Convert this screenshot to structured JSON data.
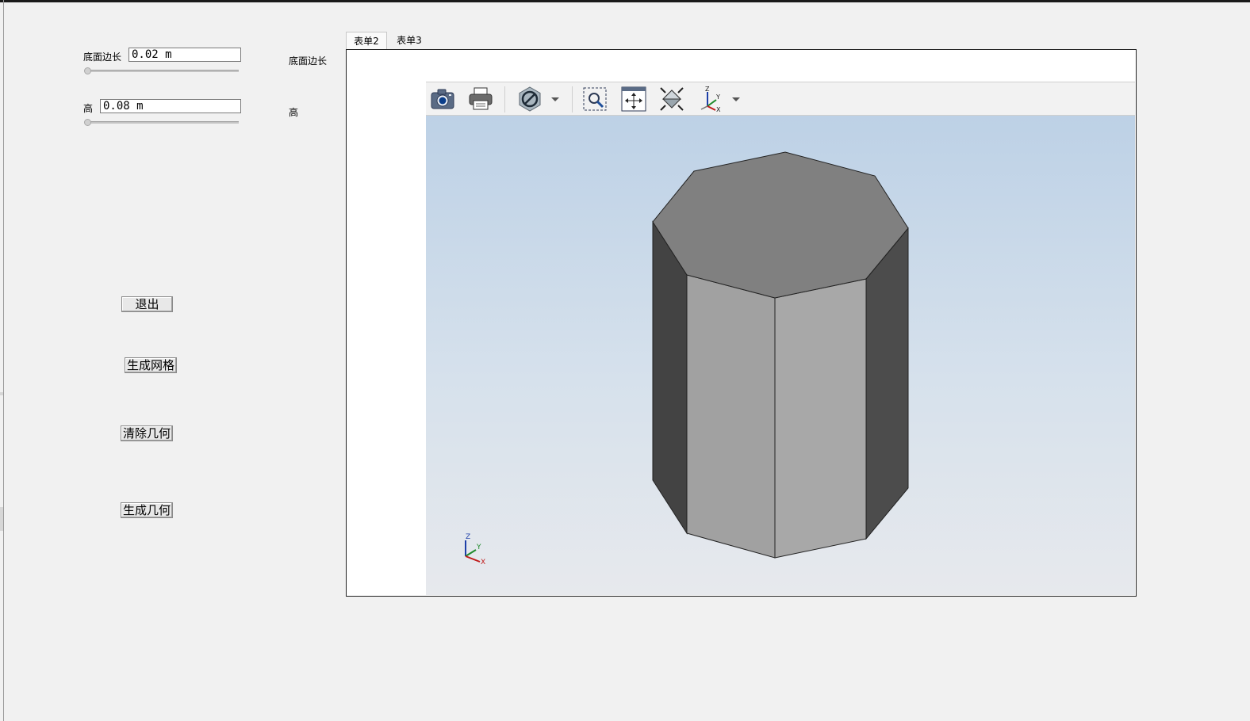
{
  "left_panel": {
    "base_edge": {
      "label": "底面边长",
      "value": "0.02 m",
      "side_label": "底面边长"
    },
    "height": {
      "label": "高",
      "value": "0.08 m",
      "side_label": "高"
    },
    "buttons": {
      "exit": "退出",
      "mesh": "生成网格",
      "clear": "清除几何",
      "generate": "生成几何"
    }
  },
  "tabs": [
    {
      "label": "表单2",
      "active": true
    },
    {
      "label": "表单3",
      "active": false
    }
  ],
  "toolbar": {
    "icons": [
      "camera-icon",
      "print-icon",
      "clip-plane-icon",
      "zoom-box-icon",
      "pan-icon",
      "zoom-extents-icon",
      "view-axes-icon"
    ]
  },
  "viewport": {
    "shape": "octagonal-prism",
    "triad_labels": {
      "z": "Z",
      "y": "Y",
      "x": "X"
    },
    "colors": {
      "top": "#808080",
      "front_left": "#a1a1a1",
      "front_right": "#a8a8a8",
      "side_left": "#434343",
      "side_right": "#4c4c4c"
    }
  }
}
